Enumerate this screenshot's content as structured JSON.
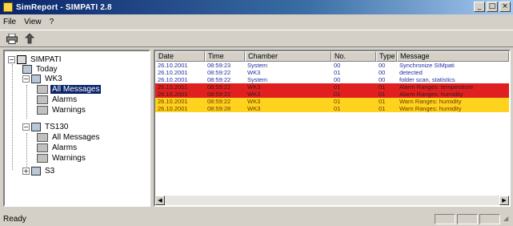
{
  "window": {
    "title": "SimReport - SIMPATI 2.8",
    "controls": [
      "_",
      "□",
      "×"
    ]
  },
  "menu": [
    {
      "label": "File"
    },
    {
      "label": "View"
    },
    {
      "label": "?"
    }
  ],
  "toolbar": {
    "print_icon": "printer-icon",
    "upload_icon": "upload-icon"
  },
  "tree": {
    "root": {
      "label": "SIMPATI"
    },
    "today": {
      "label": "Today"
    },
    "groups": [
      {
        "label": "WK3",
        "items": [
          {
            "label": "All Messages"
          },
          {
            "label": "Alarms"
          },
          {
            "label": "Warnings"
          }
        ]
      },
      {
        "label": "TS130",
        "items": [
          {
            "label": "All Messages"
          },
          {
            "label": "Alarms"
          },
          {
            "label": "Warnings"
          }
        ]
      },
      {
        "label": "S3"
      }
    ],
    "selected": "WK3 / All Messages"
  },
  "list": {
    "columns": [
      {
        "label": "Date"
      },
      {
        "label": "Time"
      },
      {
        "label": "Chamber"
      },
      {
        "label": "No."
      },
      {
        "label": "Type"
      },
      {
        "label": "Message"
      }
    ],
    "rows": [
      {
        "kind": "info",
        "cells": [
          "26.10.2001",
          "08:59:23",
          "System",
          "00",
          "00",
          "Synchronize SIMpati"
        ]
      },
      {
        "kind": "info",
        "cells": [
          "26.10.2001",
          "08:59:22",
          "WK3",
          "01",
          "00",
          "detected"
        ]
      },
      {
        "kind": "info",
        "cells": [
          "26.10.2001",
          "08:59:22",
          "System",
          "00",
          "00",
          "folder scan, statistics"
        ]
      },
      {
        "kind": "alarm",
        "cells": [
          "26.10.2001",
          "08:59:22",
          "WK3",
          "01",
          "01",
          "Alarm Ranges: temperature"
        ]
      },
      {
        "kind": "alarm",
        "cells": [
          "26.10.2001",
          "08:59:22",
          "WK3",
          "01",
          "01",
          "Alarm Ranges: humidity"
        ]
      },
      {
        "kind": "warn",
        "cells": [
          "26.10.2001",
          "08:59:22",
          "WK3",
          "01",
          "01",
          "Warn Ranges: humidity"
        ]
      },
      {
        "kind": "warn",
        "cells": [
          "26.10.2001",
          "08:59:28",
          "WK3",
          "01",
          "01",
          "Warn Ranges: humidity"
        ]
      }
    ],
    "colors": {
      "info_text": "#2030a0",
      "alarm_bg": "#e02020",
      "warn_bg": "#ffd21e"
    }
  },
  "status": {
    "text": "Ready"
  }
}
